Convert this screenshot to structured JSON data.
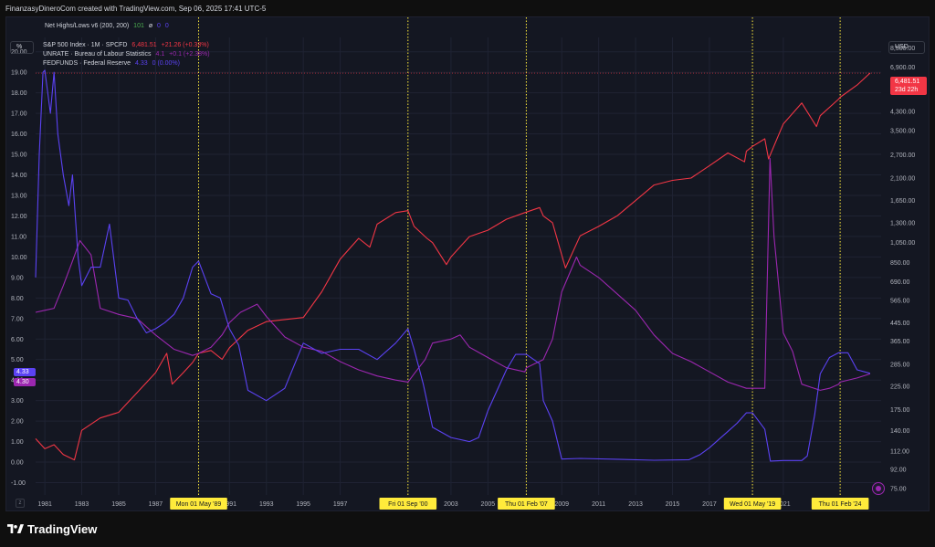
{
  "header": {
    "caption": "FinanzasyDineroCom created with TradingView.com, Sep 06, 2025 17:41 UTC-5"
  },
  "indicator": {
    "name": "Net Highs/Lows v6 (200, 200)",
    "values": [
      "101",
      "ø",
      "0",
      "0"
    ]
  },
  "legend": [
    {
      "name": "S&P 500 Index · 1M · SPCFD",
      "value": "6,481.51",
      "change": "+21.26 (+0.33%)",
      "color": "#f23645"
    },
    {
      "name": "UNRATE · Bureau of Labour Statistics",
      "value": "4.1",
      "change": "+0.1 (+2.38%)",
      "color": "#9c27b0"
    },
    {
      "name": "FEDFUNDS · Federal Reserve",
      "value": "4.33",
      "change": "0 (0.00%)",
      "color": "#5b42f3"
    }
  ],
  "buttons": {
    "left_scale": "%",
    "right_scale": "USD"
  },
  "colors": {
    "sp500": "#f23645",
    "unrate": "#9c27b0",
    "fedfunds": "#5b42f3",
    "marker": "#ffeb3b",
    "background": "#141722"
  },
  "price_chips": {
    "fedfunds": "4.33",
    "unrate": "4.30",
    "sp500_price": "6,481.51",
    "sp500_countdown": "23d 22h"
  },
  "brand": {
    "name": "TradingView"
  },
  "chart_data": {
    "type": "line",
    "title": "",
    "x_range": [
      1980.5,
      2026.3
    ],
    "left_axis": {
      "unit": "%",
      "range": [
        -1.6,
        20.7
      ],
      "ticks": [
        "20.00",
        "19.00",
        "18.00",
        "17.00",
        "16.00",
        "15.00",
        "14.00",
        "13.00",
        "12.00",
        "11.00",
        "10.00",
        "9.00",
        "8.00",
        "7.00",
        "6.00",
        "5.00",
        "4.00",
        "3.00",
        "2.00",
        "1.00",
        "0.00",
        "-1.00"
      ]
    },
    "right_axis": {
      "unit": "USD",
      "scale": "log",
      "range": [
        70,
        9500
      ],
      "ticks": [
        "8,500.00",
        "6,900.00",
        "5,300.00",
        "4,300.00",
        "3,500.00",
        "2,700.00",
        "2,100.00",
        "1,650.00",
        "1,300.00",
        "1,050.00",
        "850.00",
        "690.00",
        "565.00",
        "445.00",
        "365.00",
        "285.00",
        "225.00",
        "175.00",
        "140.00",
        "112.00",
        "92.00",
        "75.00"
      ]
    },
    "x_ticks": [
      "1981",
      "1983",
      "1985",
      "1987",
      "1991",
      "1993",
      "1995",
      "1997",
      "2003",
      "2005",
      "2009",
      "2011",
      "2013",
      "2015",
      "2017",
      "2021"
    ],
    "x_tick_years": [
      1981,
      1983,
      1985,
      1987,
      1991,
      1993,
      1995,
      1997,
      2003,
      2005,
      2009,
      2011,
      2013,
      2015,
      2017,
      2021
    ],
    "markers": [
      {
        "x": 1989.33,
        "label": "Mon 01 May '89"
      },
      {
        "x": 2000.67,
        "label": "Fri 01 Sep '00"
      },
      {
        "x": 2007.08,
        "label": "Thu 01 Feb '07"
      },
      {
        "x": 2019.33,
        "label": "Wed 01 May '19"
      },
      {
        "x": 2024.08,
        "label": "Thu 01 Feb '24"
      }
    ],
    "series": [
      {
        "name": "S&P 500 Index",
        "axis": "right",
        "x": [
          1980.5,
          1981,
          1981.5,
          1982,
          1982.6,
          1983,
          1984,
          1985,
          1986,
          1987,
          1987.6,
          1987.9,
          1988.5,
          1989,
          1989.33,
          1990,
          1990.6,
          1991,
          1992,
          1993,
          1994,
          1995,
          1996,
          1997,
          1998,
          1998.6,
          1999,
          2000,
          2000.67,
          2001,
          2001.7,
          2002,
          2002.75,
          2003,
          2004,
          2005,
          2006,
          2007,
          2007.8,
          2008,
          2008.5,
          2009.2,
          2010,
          2011,
          2012,
          2013,
          2014,
          2015,
          2016,
          2017,
          2018,
          2018.9,
          2019,
          2019.33,
          2020,
          2020.2,
          2021,
          2022,
          2022.8,
          2023,
          2024,
          2024.08,
          2025,
          2025.7
        ],
        "y": [
          128,
          115,
          120,
          108,
          102,
          140,
          160,
          170,
          210,
          260,
          320,
          230,
          260,
          290,
          320,
          330,
          300,
          340,
          410,
          450,
          460,
          470,
          620,
          880,
          1100,
          1000,
          1280,
          1450,
          1480,
          1250,
          1100,
          1050,
          830,
          900,
          1120,
          1200,
          1350,
          1450,
          1530,
          1400,
          1300,
          800,
          1130,
          1250,
          1400,
          1650,
          1950,
          2050,
          2100,
          2400,
          2750,
          2500,
          2800,
          2950,
          3200,
          2580,
          3750,
          4700,
          3650,
          4100,
          4900,
          5000,
          5700,
          6481
        ]
      },
      {
        "name": "UNRATE",
        "axis": "left",
        "x": [
          1980.5,
          1981,
          1981.5,
          1982,
          1982.5,
          1982.9,
          1983.5,
          1984,
          1985,
          1986,
          1987,
          1988,
          1989,
          1989.33,
          1990,
          1990.6,
          1991,
          1991.6,
          1992.5,
          1993,
          1994,
          1995,
          1996,
          1997,
          1998,
          1999,
          2000,
          2000.67,
          2001,
          2001.6,
          2002,
          2003,
          2003.5,
          2004,
          2005,
          2006,
          2007,
          2007.08,
          2008,
          2008.5,
          2009,
          2009.8,
          2010,
          2011,
          2012,
          2013,
          2014,
          2015,
          2016,
          2017,
          2018,
          2019,
          2019.33,
          2020,
          2020.28,
          2020.5,
          2021,
          2021.5,
          2022,
          2023,
          2023.5,
          2024,
          2024.08,
          2025,
          2025.7
        ],
        "y": [
          7.3,
          7.4,
          7.5,
          8.6,
          9.8,
          10.8,
          10.1,
          7.5,
          7.2,
          7.0,
          6.2,
          5.5,
          5.2,
          5.3,
          5.6,
          6.2,
          6.8,
          7.3,
          7.7,
          7.1,
          6.1,
          5.6,
          5.4,
          4.9,
          4.5,
          4.2,
          4.0,
          3.9,
          4.3,
          5.0,
          5.8,
          6.0,
          6.2,
          5.6,
          5.1,
          4.6,
          4.4,
          4.6,
          5.0,
          6.0,
          8.3,
          10.0,
          9.6,
          9.0,
          8.2,
          7.4,
          6.2,
          5.3,
          4.9,
          4.4,
          3.9,
          3.6,
          3.6,
          3.6,
          14.8,
          11.0,
          6.3,
          5.4,
          3.8,
          3.5,
          3.6,
          3.8,
          3.9,
          4.1,
          4.3
        ]
      },
      {
        "name": "FEDFUNDS",
        "axis": "left",
        "x": [
          1980.5,
          1980.7,
          1980.9,
          1981,
          1981.3,
          1981.5,
          1981.7,
          1982,
          1982.3,
          1982.5,
          1982.8,
          1983,
          1983.5,
          1984,
          1984.5,
          1985,
          1985.5,
          1986,
          1986.5,
          1987,
          1987.5,
          1988,
          1988.5,
          1989,
          1989.33,
          1990,
          1990.5,
          1991,
          1991.5,
          1992,
          1993,
          1994,
          1995,
          1996,
          1997,
          1998,
          1999,
          2000,
          2000.67,
          2001,
          2001.5,
          2002,
          2003,
          2004,
          2004.5,
          2005,
          2006,
          2006.5,
          2007,
          2007.08,
          2007.8,
          2008,
          2008.5,
          2009,
          2010,
          2012,
          2014,
          2015.9,
          2016.5,
          2017,
          2017.5,
          2018,
          2018.5,
          2019,
          2019.33,
          2019.5,
          2020,
          2020.3,
          2021,
          2022,
          2022.3,
          2022.7,
          2023,
          2023.5,
          2024,
          2024.08,
          2024.5,
          2025,
          2025.7
        ],
        "y": [
          9.0,
          15.0,
          19.0,
          19.1,
          17.0,
          19.0,
          16.0,
          14.0,
          12.5,
          14.0,
          10.0,
          8.6,
          9.5,
          9.5,
          11.6,
          8.0,
          7.9,
          7.0,
          6.3,
          6.5,
          6.8,
          7.2,
          8.0,
          9.5,
          9.8,
          8.2,
          8.0,
          6.5,
          5.7,
          3.5,
          3.0,
          3.6,
          5.8,
          5.3,
          5.5,
          5.5,
          5.0,
          5.8,
          6.5,
          5.5,
          3.8,
          1.7,
          1.2,
          1.0,
          1.2,
          2.5,
          4.5,
          5.25,
          5.25,
          5.25,
          4.8,
          3.0,
          2.0,
          0.15,
          0.18,
          0.14,
          0.09,
          0.12,
          0.37,
          0.7,
          1.1,
          1.5,
          1.9,
          2.4,
          2.4,
          2.2,
          1.6,
          0.05,
          0.08,
          0.08,
          0.3,
          2.3,
          4.3,
          5.1,
          5.33,
          5.33,
          5.33,
          4.5,
          4.33
        ]
      }
    ]
  }
}
